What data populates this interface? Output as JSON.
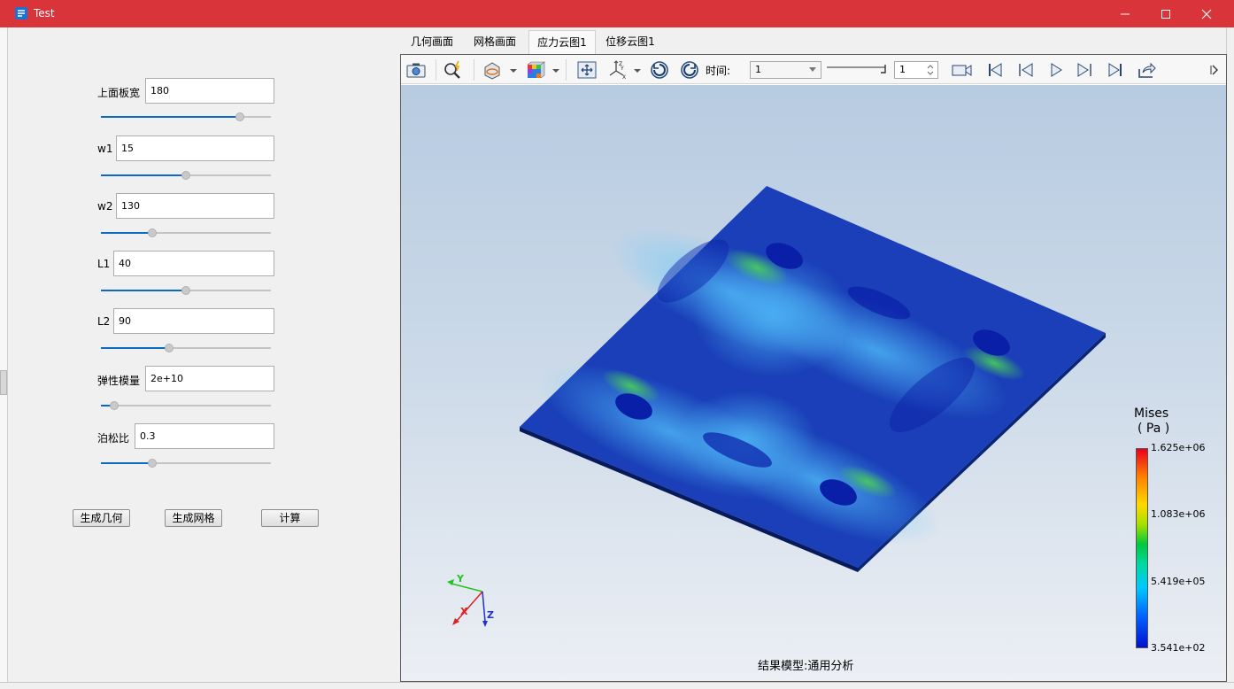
{
  "window": {
    "title": "Test"
  },
  "params": [
    {
      "label": "上面板宽",
      "value": "180",
      "slider": 0.82
    },
    {
      "label": "w1",
      "value": "15",
      "slider": 0.5
    },
    {
      "label": "w2",
      "value": "130",
      "slider": 0.3
    },
    {
      "label": "L1",
      "value": "40",
      "slider": 0.5
    },
    {
      "label": "L2",
      "value": "90",
      "slider": 0.4
    },
    {
      "label": "弹性模量",
      "value": "2e+10",
      "slider": 0.08
    },
    {
      "label": "泊松比",
      "value": "0.3",
      "slider": 0.3
    }
  ],
  "actions": {
    "gen_geometry": "生成几何",
    "gen_mesh": "生成网格",
    "compute": "计算"
  },
  "tabs": [
    {
      "label": "几何画面",
      "active": false
    },
    {
      "label": "网格画面",
      "active": false
    },
    {
      "label": "应力云图1",
      "active": true
    },
    {
      "label": "位移云图1",
      "active": false
    }
  ],
  "toolbar": {
    "icons": [
      "camera-icon",
      "zoom-flash-icon",
      "cut-plane-icon",
      "color-cube-icon",
      "pan-fit-icon",
      "axes-icon",
      "rotate-left-icon",
      "rotate-right-icon",
      "record-icon",
      "first-frame-icon",
      "prev-frame-icon",
      "play-icon",
      "next-frame-icon",
      "last-frame-icon",
      "export-icon"
    ],
    "time_label": "时间:",
    "time_value": "1",
    "frame_value": "1"
  },
  "legend": {
    "title": "Mises",
    "unit": "( Pa )",
    "max": "1.625e+06",
    "v2": "1.083e+06",
    "v3": "5.419e+05",
    "min": "3.541e+02"
  },
  "axes": {
    "x": "X",
    "y": "Y",
    "z": "Z"
  },
  "caption": "结果模型:通用分析",
  "colors": {
    "titlebar": "#d9343a",
    "accent": "#0b6ac2",
    "plate_base": "#1a3fb8"
  }
}
